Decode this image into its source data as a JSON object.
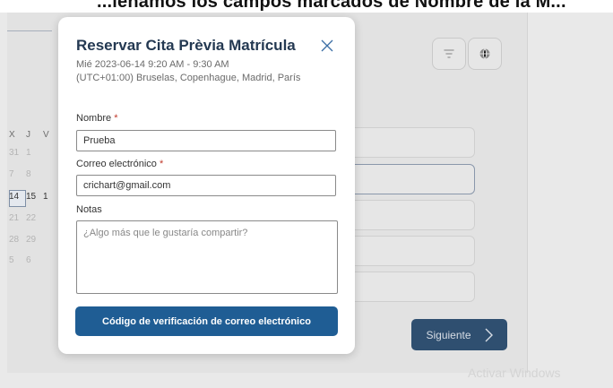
{
  "banner": {
    "text": "...lenamos los campos marcados de Nombre de la M..."
  },
  "background": {
    "calendar": {
      "headers": [
        "X",
        "J",
        "V"
      ],
      "rows": [
        [
          "31",
          "1",
          ""
        ],
        [
          "7",
          "8",
          ""
        ],
        [
          "14",
          "15",
          "1"
        ],
        [
          "21",
          "22",
          ""
        ],
        [
          "28",
          "29",
          ""
        ],
        [
          "5",
          "6",
          ""
        ]
      ]
    },
    "next_button": {
      "label": "Siguiente"
    },
    "watermark": "Activar Windows"
  },
  "modal": {
    "title": "Reservar Cita Prèvia Matrícula",
    "datetime": "Mié 2023-06-14 9:20 AM - 9:30 AM",
    "timezone": "(UTC+01:00) Bruselas, Copenhague, Madrid, París",
    "fields": {
      "name": {
        "label": "Nombre",
        "required": "*",
        "value": "Prueba"
      },
      "email": {
        "label": "Correo electrónico",
        "required": "*",
        "value": "crichart@gmail.com"
      },
      "notes": {
        "label": "Notas",
        "placeholder": "¿Algo más que le gustaría compartir?"
      }
    },
    "verify_button": {
      "label": "Código de verificación de correo electrónico"
    }
  }
}
